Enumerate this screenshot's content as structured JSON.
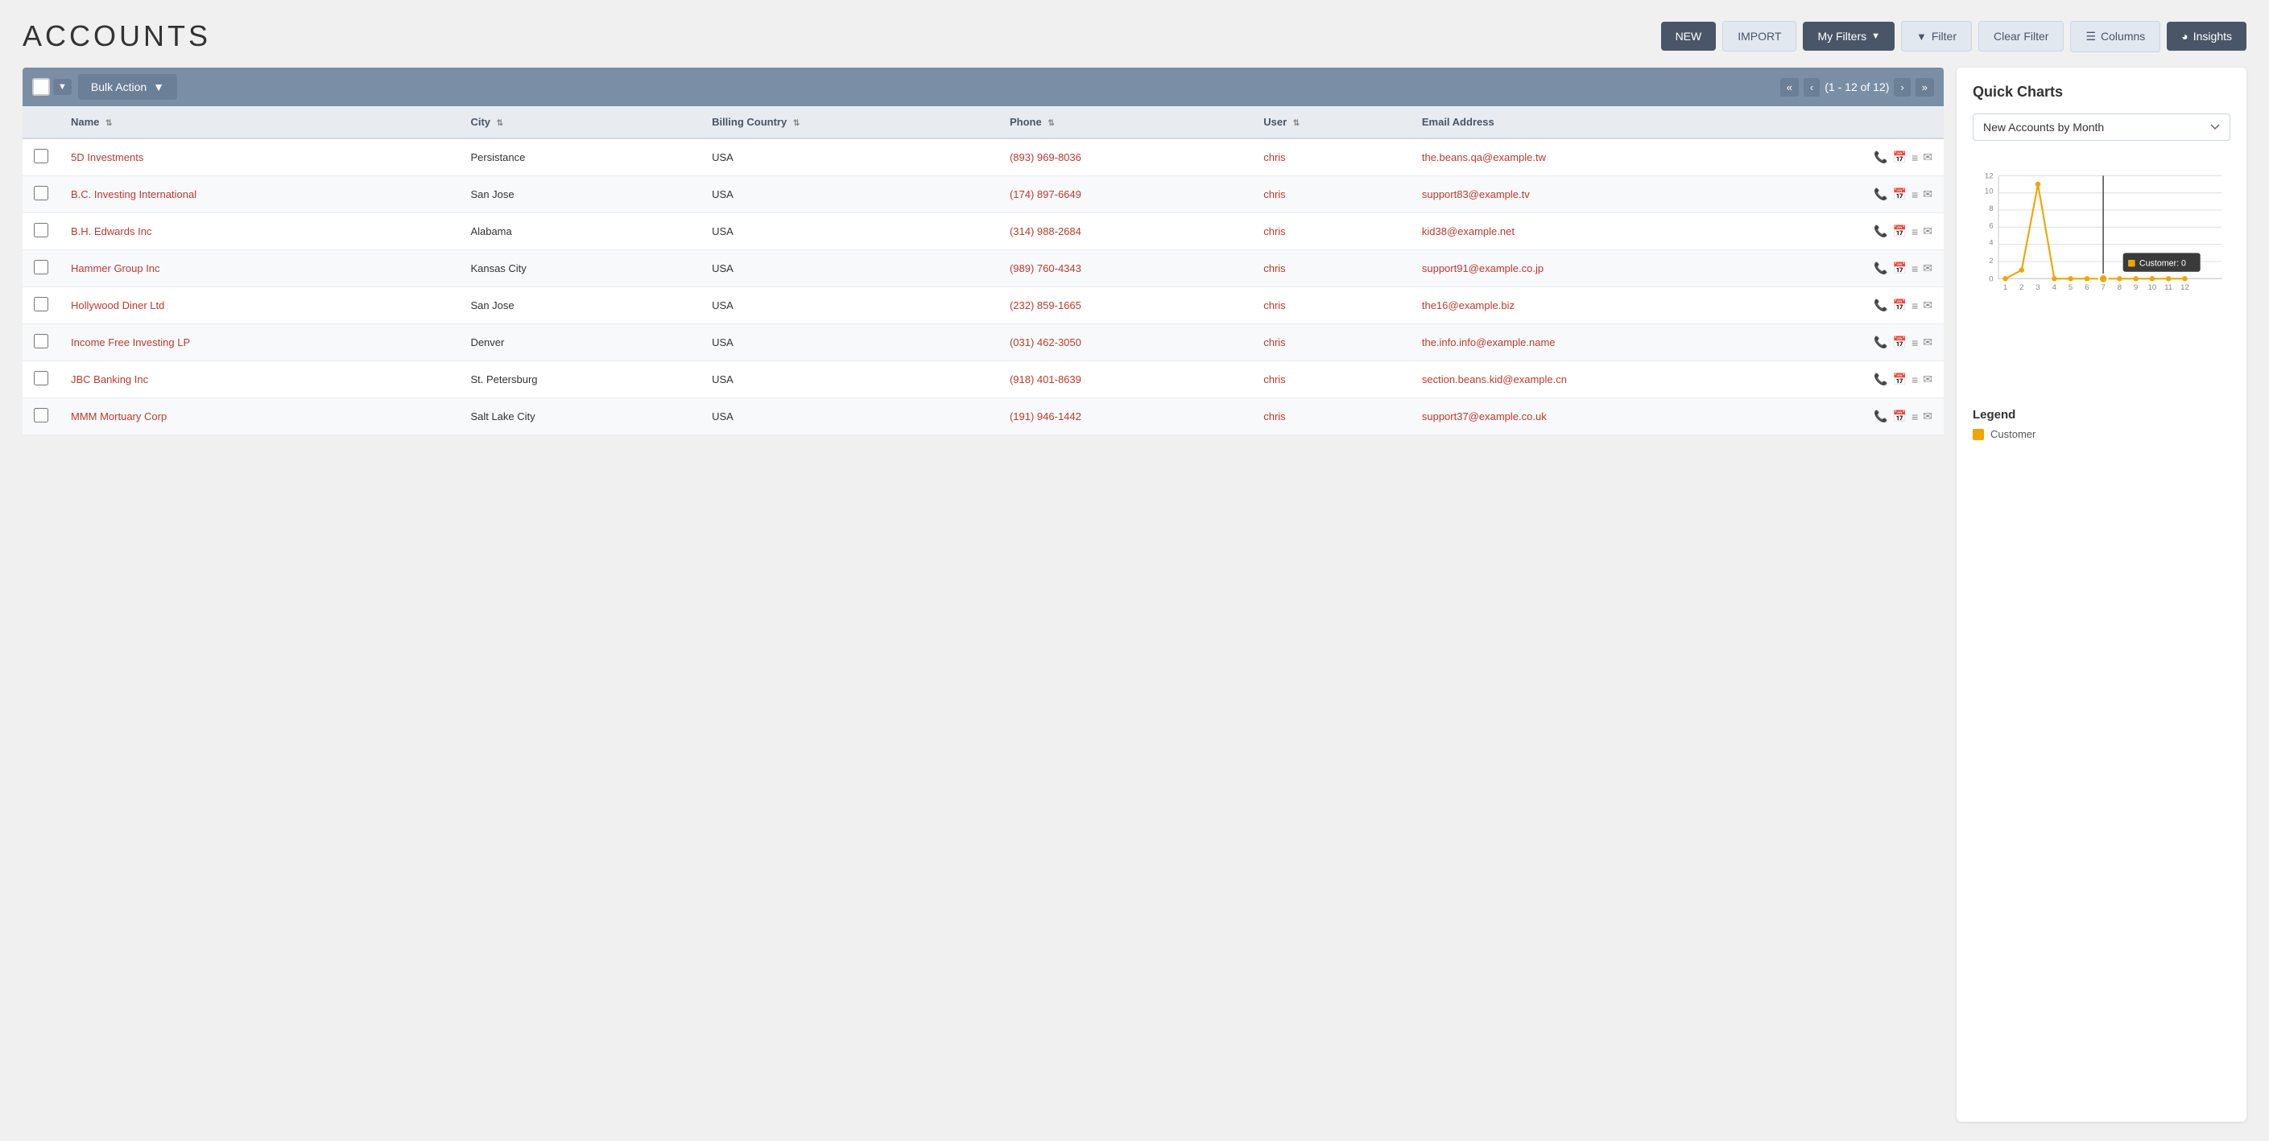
{
  "page": {
    "title": "ACCOUNTS"
  },
  "header": {
    "buttons": {
      "new_label": "NEW",
      "import_label": "IMPORT",
      "my_filters_label": "My Filters",
      "filter_label": "Filter",
      "clear_filter_label": "Clear Filter",
      "columns_label": "Columns",
      "insights_label": "Insights"
    }
  },
  "toolbar": {
    "bulk_action_label": "Bulk Action",
    "pagination_text": "(1 - 12 of 12)"
  },
  "table": {
    "columns": [
      {
        "id": "name",
        "label": "Name"
      },
      {
        "id": "city",
        "label": "City"
      },
      {
        "id": "billing_country",
        "label": "Billing Country"
      },
      {
        "id": "phone",
        "label": "Phone"
      },
      {
        "id": "user",
        "label": "User"
      },
      {
        "id": "email",
        "label": "Email Address"
      }
    ],
    "rows": [
      {
        "id": 1,
        "name": "5D Investments",
        "city": "Persistance",
        "country": "USA",
        "phone": "(893) 969-8036",
        "user": "chris",
        "email": "the.beans.qa@example.tw"
      },
      {
        "id": 2,
        "name": "B.C. Investing International",
        "city": "San Jose",
        "country": "USA",
        "phone": "(174) 897-6649",
        "user": "chris",
        "email": "support83@example.tv"
      },
      {
        "id": 3,
        "name": "B.H. Edwards Inc",
        "city": "Alabama",
        "country": "USA",
        "phone": "(314) 988-2684",
        "user": "chris",
        "email": "kid38@example.net"
      },
      {
        "id": 4,
        "name": "Hammer Group Inc",
        "city": "Kansas City",
        "country": "USA",
        "phone": "(989) 760-4343",
        "user": "chris",
        "email": "support91@example.co.jp"
      },
      {
        "id": 5,
        "name": "Hollywood Diner Ltd",
        "city": "San Jose",
        "country": "USA",
        "phone": "(232) 859-1665",
        "user": "chris",
        "email": "the16@example.biz"
      },
      {
        "id": 6,
        "name": "Income Free Investing LP",
        "city": "Denver",
        "country": "USA",
        "phone": "(031) 462-3050",
        "user": "chris",
        "email": "the.info.info@example.name"
      },
      {
        "id": 7,
        "name": "JBC Banking Inc",
        "city": "St. Petersburg",
        "country": "USA",
        "phone": "(918) 401-8639",
        "user": "chris",
        "email": "section.beans.kid@example.cn"
      },
      {
        "id": 8,
        "name": "MMM Mortuary Corp",
        "city": "Salt Lake City",
        "country": "USA",
        "phone": "(191) 946-1442",
        "user": "chris",
        "email": "support37@example.co.uk"
      }
    ]
  },
  "insights_panel": {
    "title": "Quick Charts",
    "chart_select": "New Accounts by Month",
    "chart": {
      "x_labels": [
        "1",
        "2",
        "3",
        "4",
        "5",
        "6",
        "7",
        "8",
        "9",
        "10",
        "11",
        "12"
      ],
      "y_max": 12,
      "y_labels": [
        "0",
        "2",
        "4",
        "6",
        "8",
        "10",
        "12"
      ],
      "data_points": [
        {
          "month": 1,
          "value": 0
        },
        {
          "month": 2,
          "value": 1
        },
        {
          "month": 3,
          "value": 11
        },
        {
          "month": 4,
          "value": 0
        },
        {
          "month": 5,
          "value": 0
        },
        {
          "month": 6,
          "value": 0
        },
        {
          "month": 7,
          "value": 0
        },
        {
          "month": 8,
          "value": 0
        },
        {
          "month": 9,
          "value": 0
        },
        {
          "month": 10,
          "value": 0
        },
        {
          "month": 11,
          "value": 0
        },
        {
          "month": 12,
          "value": 0
        }
      ],
      "tooltip": {
        "label": "Customer: 0",
        "month": 7
      }
    },
    "legend": {
      "title": "Legend",
      "items": [
        {
          "label": "Customer",
          "color": "#f0a500"
        }
      ]
    }
  }
}
